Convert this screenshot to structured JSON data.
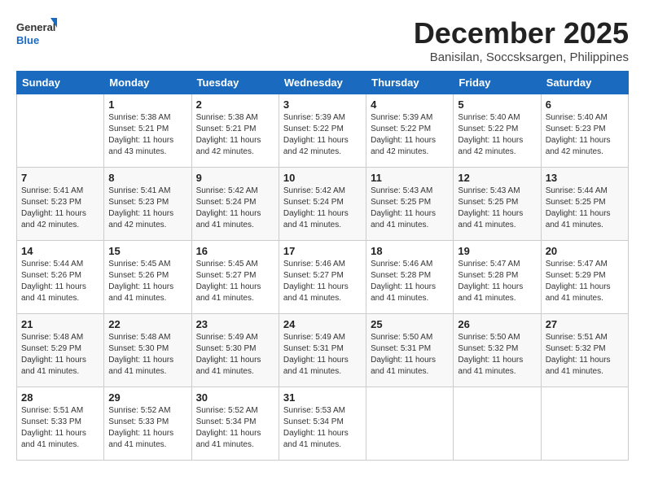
{
  "header": {
    "logo_general": "General",
    "logo_blue": "Blue",
    "title": "December 2025",
    "subtitle": "Banisilan, Soccsksargen, Philippines"
  },
  "weekdays": [
    "Sunday",
    "Monday",
    "Tuesday",
    "Wednesday",
    "Thursday",
    "Friday",
    "Saturday"
  ],
  "weeks": [
    [
      {
        "day": "",
        "sunrise": "",
        "sunset": "",
        "daylight": ""
      },
      {
        "day": "1",
        "sunrise": "Sunrise: 5:38 AM",
        "sunset": "Sunset: 5:21 PM",
        "daylight": "Daylight: 11 hours and 43 minutes."
      },
      {
        "day": "2",
        "sunrise": "Sunrise: 5:38 AM",
        "sunset": "Sunset: 5:21 PM",
        "daylight": "Daylight: 11 hours and 42 minutes."
      },
      {
        "day": "3",
        "sunrise": "Sunrise: 5:39 AM",
        "sunset": "Sunset: 5:22 PM",
        "daylight": "Daylight: 11 hours and 42 minutes."
      },
      {
        "day": "4",
        "sunrise": "Sunrise: 5:39 AM",
        "sunset": "Sunset: 5:22 PM",
        "daylight": "Daylight: 11 hours and 42 minutes."
      },
      {
        "day": "5",
        "sunrise": "Sunrise: 5:40 AM",
        "sunset": "Sunset: 5:22 PM",
        "daylight": "Daylight: 11 hours and 42 minutes."
      },
      {
        "day": "6",
        "sunrise": "Sunrise: 5:40 AM",
        "sunset": "Sunset: 5:23 PM",
        "daylight": "Daylight: 11 hours and 42 minutes."
      }
    ],
    [
      {
        "day": "7",
        "sunrise": "Sunrise: 5:41 AM",
        "sunset": "Sunset: 5:23 PM",
        "daylight": "Daylight: 11 hours and 42 minutes."
      },
      {
        "day": "8",
        "sunrise": "Sunrise: 5:41 AM",
        "sunset": "Sunset: 5:23 PM",
        "daylight": "Daylight: 11 hours and 42 minutes."
      },
      {
        "day": "9",
        "sunrise": "Sunrise: 5:42 AM",
        "sunset": "Sunset: 5:24 PM",
        "daylight": "Daylight: 11 hours and 41 minutes."
      },
      {
        "day": "10",
        "sunrise": "Sunrise: 5:42 AM",
        "sunset": "Sunset: 5:24 PM",
        "daylight": "Daylight: 11 hours and 41 minutes."
      },
      {
        "day": "11",
        "sunrise": "Sunrise: 5:43 AM",
        "sunset": "Sunset: 5:25 PM",
        "daylight": "Daylight: 11 hours and 41 minutes."
      },
      {
        "day": "12",
        "sunrise": "Sunrise: 5:43 AM",
        "sunset": "Sunset: 5:25 PM",
        "daylight": "Daylight: 11 hours and 41 minutes."
      },
      {
        "day": "13",
        "sunrise": "Sunrise: 5:44 AM",
        "sunset": "Sunset: 5:25 PM",
        "daylight": "Daylight: 11 hours and 41 minutes."
      }
    ],
    [
      {
        "day": "14",
        "sunrise": "Sunrise: 5:44 AM",
        "sunset": "Sunset: 5:26 PM",
        "daylight": "Daylight: 11 hours and 41 minutes."
      },
      {
        "day": "15",
        "sunrise": "Sunrise: 5:45 AM",
        "sunset": "Sunset: 5:26 PM",
        "daylight": "Daylight: 11 hours and 41 minutes."
      },
      {
        "day": "16",
        "sunrise": "Sunrise: 5:45 AM",
        "sunset": "Sunset: 5:27 PM",
        "daylight": "Daylight: 11 hours and 41 minutes."
      },
      {
        "day": "17",
        "sunrise": "Sunrise: 5:46 AM",
        "sunset": "Sunset: 5:27 PM",
        "daylight": "Daylight: 11 hours and 41 minutes."
      },
      {
        "day": "18",
        "sunrise": "Sunrise: 5:46 AM",
        "sunset": "Sunset: 5:28 PM",
        "daylight": "Daylight: 11 hours and 41 minutes."
      },
      {
        "day": "19",
        "sunrise": "Sunrise: 5:47 AM",
        "sunset": "Sunset: 5:28 PM",
        "daylight": "Daylight: 11 hours and 41 minutes."
      },
      {
        "day": "20",
        "sunrise": "Sunrise: 5:47 AM",
        "sunset": "Sunset: 5:29 PM",
        "daylight": "Daylight: 11 hours and 41 minutes."
      }
    ],
    [
      {
        "day": "21",
        "sunrise": "Sunrise: 5:48 AM",
        "sunset": "Sunset: 5:29 PM",
        "daylight": "Daylight: 11 hours and 41 minutes."
      },
      {
        "day": "22",
        "sunrise": "Sunrise: 5:48 AM",
        "sunset": "Sunset: 5:30 PM",
        "daylight": "Daylight: 11 hours and 41 minutes."
      },
      {
        "day": "23",
        "sunrise": "Sunrise: 5:49 AM",
        "sunset": "Sunset: 5:30 PM",
        "daylight": "Daylight: 11 hours and 41 minutes."
      },
      {
        "day": "24",
        "sunrise": "Sunrise: 5:49 AM",
        "sunset": "Sunset: 5:31 PM",
        "daylight": "Daylight: 11 hours and 41 minutes."
      },
      {
        "day": "25",
        "sunrise": "Sunrise: 5:50 AM",
        "sunset": "Sunset: 5:31 PM",
        "daylight": "Daylight: 11 hours and 41 minutes."
      },
      {
        "day": "26",
        "sunrise": "Sunrise: 5:50 AM",
        "sunset": "Sunset: 5:32 PM",
        "daylight": "Daylight: 11 hours and 41 minutes."
      },
      {
        "day": "27",
        "sunrise": "Sunrise: 5:51 AM",
        "sunset": "Sunset: 5:32 PM",
        "daylight": "Daylight: 11 hours and 41 minutes."
      }
    ],
    [
      {
        "day": "28",
        "sunrise": "Sunrise: 5:51 AM",
        "sunset": "Sunset: 5:33 PM",
        "daylight": "Daylight: 11 hours and 41 minutes."
      },
      {
        "day": "29",
        "sunrise": "Sunrise: 5:52 AM",
        "sunset": "Sunset: 5:33 PM",
        "daylight": "Daylight: 11 hours and 41 minutes."
      },
      {
        "day": "30",
        "sunrise": "Sunrise: 5:52 AM",
        "sunset": "Sunset: 5:34 PM",
        "daylight": "Daylight: 11 hours and 41 minutes."
      },
      {
        "day": "31",
        "sunrise": "Sunrise: 5:53 AM",
        "sunset": "Sunset: 5:34 PM",
        "daylight": "Daylight: 11 hours and 41 minutes."
      },
      {
        "day": "",
        "sunrise": "",
        "sunset": "",
        "daylight": ""
      },
      {
        "day": "",
        "sunrise": "",
        "sunset": "",
        "daylight": ""
      },
      {
        "day": "",
        "sunrise": "",
        "sunset": "",
        "daylight": ""
      }
    ]
  ]
}
